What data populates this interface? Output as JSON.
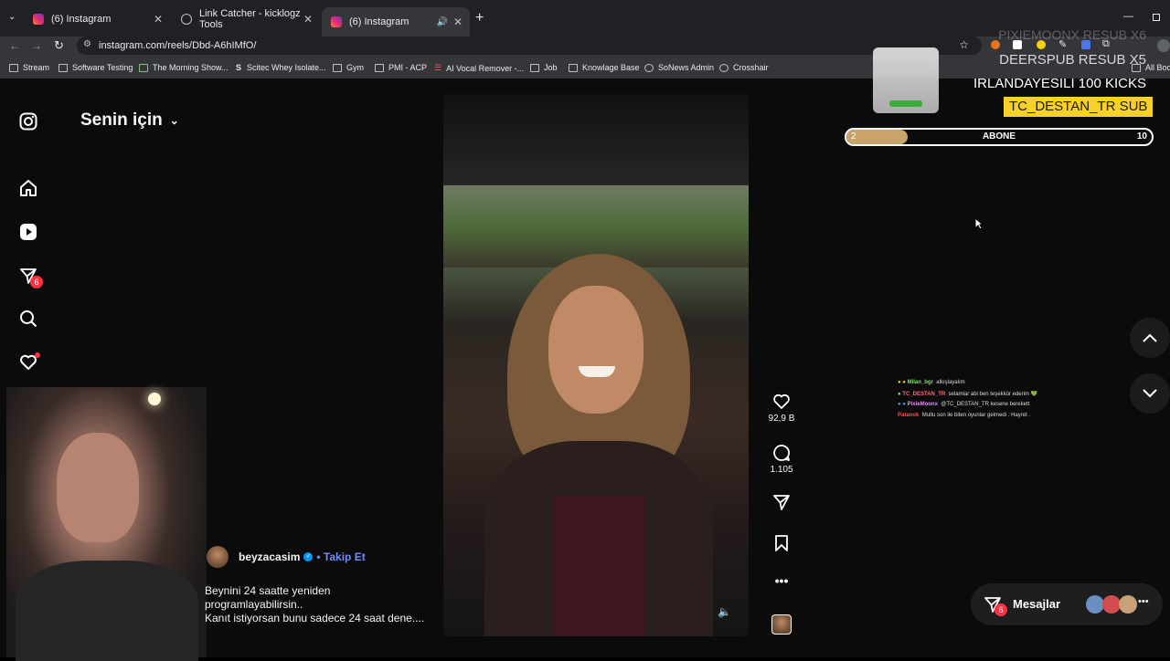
{
  "browser": {
    "tabs": [
      {
        "title": "(6) Instagram",
        "active": false
      },
      {
        "title": "Link Catcher - kicklogz Tools",
        "active": false
      },
      {
        "title": "(6) Instagram",
        "active": true
      }
    ],
    "url": "instagram.com/reels/Dbd-A6hIMfO/",
    "bookmarks": [
      "Stream",
      "Software Testing",
      "The Morning Show...",
      "Scitec Whey Isolate...",
      "Gym",
      "PMI - ACP",
      "AI Vocal Remover -...",
      "Job",
      "Knowlage Base",
      "SoNews Admin",
      "Crosshair"
    ],
    "all_bookmarks": "All Book"
  },
  "instagram": {
    "feed_title": "Senin için",
    "nav_badge_count": "6",
    "author": "beyzacasim",
    "follow": "• Takip Et",
    "caption_lines": [
      "Beynini 24 saatte yeniden",
      "programlayabilirsin..",
      "Kanıt istiyorsan bunu sadece 24 saat dene...."
    ],
    "likes": "92,9 B",
    "comments": "1.105",
    "messages_label": "Mesajlar",
    "messages_badge": "6"
  },
  "stream_overlay": {
    "top_lines": [
      "PIXIEMOONX  RESUB X6",
      "DEERSPUB  RESUB X5"
    ],
    "kicks_line": "IRLANDAYESILI  100 KICKS",
    "sub_line": "TC_DESTAN_TR  SUB",
    "goal": {
      "current": "2",
      "label": "ABONE",
      "target": "10",
      "progress": 0.2
    },
    "chat": [
      {
        "user": "Milan_bgr",
        "message": "alkışlayalım",
        "color": "#7be36b"
      },
      {
        "user": "TC_DESTAN_TR",
        "message": "selamlar abi ben teşekkür ederim 💚",
        "color": "#ff6b6b"
      },
      {
        "user": "PixieMoonx",
        "message": "@TC_DESTAN_TR kesene berekett",
        "color": "#e58cff"
      },
      {
        "user": "Patanok",
        "message": "Mutlu son ile biten oyunlar gelmedi . Hayret .",
        "color": "#ff4a4a"
      }
    ]
  },
  "colors": {
    "accent": "#0095f6",
    "badge": "#ff3040",
    "sub_bg": "#f7d12a",
    "goal_fill": "#c9a46a"
  }
}
